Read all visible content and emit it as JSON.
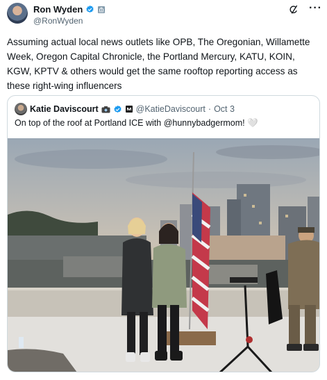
{
  "author": {
    "name": "Ron Wyden",
    "handle": "@RonWyden"
  },
  "post": {
    "text": "Assuming actual local news outlets like OPB, The Oregonian, Willamette Week, Oregon Capital Chronicle, the Portland Mercury, KATU, KOIN, KGW, KPTV & others would get the same rooftop reporting access as these right-wing influencers"
  },
  "quoted": {
    "name": "Katie Daviscourt",
    "handle": "@KatieDaviscourt",
    "separator": "·",
    "date": "Oct 3",
    "text": "On top of the roof at Portland ICE with @hunnybadgermom! 🤍"
  },
  "icons": {
    "verified": "verified-badge-icon",
    "gov": "government-badge-icon",
    "grok": "grok-icon",
    "more": "more-icon",
    "camera": "camera-emoji-icon",
    "affiliate": "affiliate-badge-icon"
  },
  "colors": {
    "verified_blue": "#1d9bf0",
    "text": "#0f1419",
    "secondary": "#536471",
    "border": "#cfd9de"
  }
}
